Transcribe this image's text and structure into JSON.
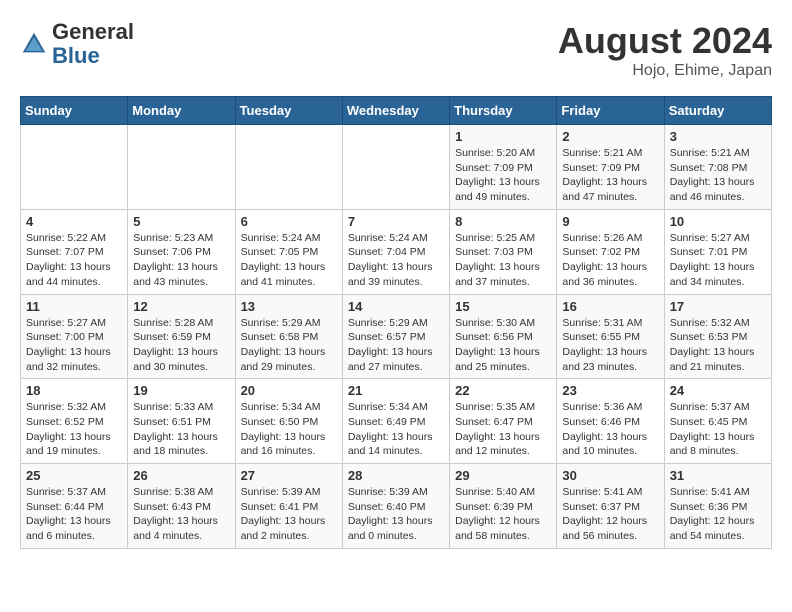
{
  "header": {
    "logo_line1": "General",
    "logo_line2": "Blue",
    "month_year": "August 2024",
    "location": "Hojo, Ehime, Japan"
  },
  "weekdays": [
    "Sunday",
    "Monday",
    "Tuesday",
    "Wednesday",
    "Thursday",
    "Friday",
    "Saturday"
  ],
  "weeks": [
    [
      {
        "day": "",
        "info": ""
      },
      {
        "day": "",
        "info": ""
      },
      {
        "day": "",
        "info": ""
      },
      {
        "day": "",
        "info": ""
      },
      {
        "day": "1",
        "info": "Sunrise: 5:20 AM\nSunset: 7:09 PM\nDaylight: 13 hours\nand 49 minutes."
      },
      {
        "day": "2",
        "info": "Sunrise: 5:21 AM\nSunset: 7:09 PM\nDaylight: 13 hours\nand 47 minutes."
      },
      {
        "day": "3",
        "info": "Sunrise: 5:21 AM\nSunset: 7:08 PM\nDaylight: 13 hours\nand 46 minutes."
      }
    ],
    [
      {
        "day": "4",
        "info": "Sunrise: 5:22 AM\nSunset: 7:07 PM\nDaylight: 13 hours\nand 44 minutes."
      },
      {
        "day": "5",
        "info": "Sunrise: 5:23 AM\nSunset: 7:06 PM\nDaylight: 13 hours\nand 43 minutes."
      },
      {
        "day": "6",
        "info": "Sunrise: 5:24 AM\nSunset: 7:05 PM\nDaylight: 13 hours\nand 41 minutes."
      },
      {
        "day": "7",
        "info": "Sunrise: 5:24 AM\nSunset: 7:04 PM\nDaylight: 13 hours\nand 39 minutes."
      },
      {
        "day": "8",
        "info": "Sunrise: 5:25 AM\nSunset: 7:03 PM\nDaylight: 13 hours\nand 37 minutes."
      },
      {
        "day": "9",
        "info": "Sunrise: 5:26 AM\nSunset: 7:02 PM\nDaylight: 13 hours\nand 36 minutes."
      },
      {
        "day": "10",
        "info": "Sunrise: 5:27 AM\nSunset: 7:01 PM\nDaylight: 13 hours\nand 34 minutes."
      }
    ],
    [
      {
        "day": "11",
        "info": "Sunrise: 5:27 AM\nSunset: 7:00 PM\nDaylight: 13 hours\nand 32 minutes."
      },
      {
        "day": "12",
        "info": "Sunrise: 5:28 AM\nSunset: 6:59 PM\nDaylight: 13 hours\nand 30 minutes."
      },
      {
        "day": "13",
        "info": "Sunrise: 5:29 AM\nSunset: 6:58 PM\nDaylight: 13 hours\nand 29 minutes."
      },
      {
        "day": "14",
        "info": "Sunrise: 5:29 AM\nSunset: 6:57 PM\nDaylight: 13 hours\nand 27 minutes."
      },
      {
        "day": "15",
        "info": "Sunrise: 5:30 AM\nSunset: 6:56 PM\nDaylight: 13 hours\nand 25 minutes."
      },
      {
        "day": "16",
        "info": "Sunrise: 5:31 AM\nSunset: 6:55 PM\nDaylight: 13 hours\nand 23 minutes."
      },
      {
        "day": "17",
        "info": "Sunrise: 5:32 AM\nSunset: 6:53 PM\nDaylight: 13 hours\nand 21 minutes."
      }
    ],
    [
      {
        "day": "18",
        "info": "Sunrise: 5:32 AM\nSunset: 6:52 PM\nDaylight: 13 hours\nand 19 minutes."
      },
      {
        "day": "19",
        "info": "Sunrise: 5:33 AM\nSunset: 6:51 PM\nDaylight: 13 hours\nand 18 minutes."
      },
      {
        "day": "20",
        "info": "Sunrise: 5:34 AM\nSunset: 6:50 PM\nDaylight: 13 hours\nand 16 minutes."
      },
      {
        "day": "21",
        "info": "Sunrise: 5:34 AM\nSunset: 6:49 PM\nDaylight: 13 hours\nand 14 minutes."
      },
      {
        "day": "22",
        "info": "Sunrise: 5:35 AM\nSunset: 6:47 PM\nDaylight: 13 hours\nand 12 minutes."
      },
      {
        "day": "23",
        "info": "Sunrise: 5:36 AM\nSunset: 6:46 PM\nDaylight: 13 hours\nand 10 minutes."
      },
      {
        "day": "24",
        "info": "Sunrise: 5:37 AM\nSunset: 6:45 PM\nDaylight: 13 hours\nand 8 minutes."
      }
    ],
    [
      {
        "day": "25",
        "info": "Sunrise: 5:37 AM\nSunset: 6:44 PM\nDaylight: 13 hours\nand 6 minutes."
      },
      {
        "day": "26",
        "info": "Sunrise: 5:38 AM\nSunset: 6:43 PM\nDaylight: 13 hours\nand 4 minutes."
      },
      {
        "day": "27",
        "info": "Sunrise: 5:39 AM\nSunset: 6:41 PM\nDaylight: 13 hours\nand 2 minutes."
      },
      {
        "day": "28",
        "info": "Sunrise: 5:39 AM\nSunset: 6:40 PM\nDaylight: 13 hours\nand 0 minutes."
      },
      {
        "day": "29",
        "info": "Sunrise: 5:40 AM\nSunset: 6:39 PM\nDaylight: 12 hours\nand 58 minutes."
      },
      {
        "day": "30",
        "info": "Sunrise: 5:41 AM\nSunset: 6:37 PM\nDaylight: 12 hours\nand 56 minutes."
      },
      {
        "day": "31",
        "info": "Sunrise: 5:41 AM\nSunset: 6:36 PM\nDaylight: 12 hours\nand 54 minutes."
      }
    ]
  ]
}
